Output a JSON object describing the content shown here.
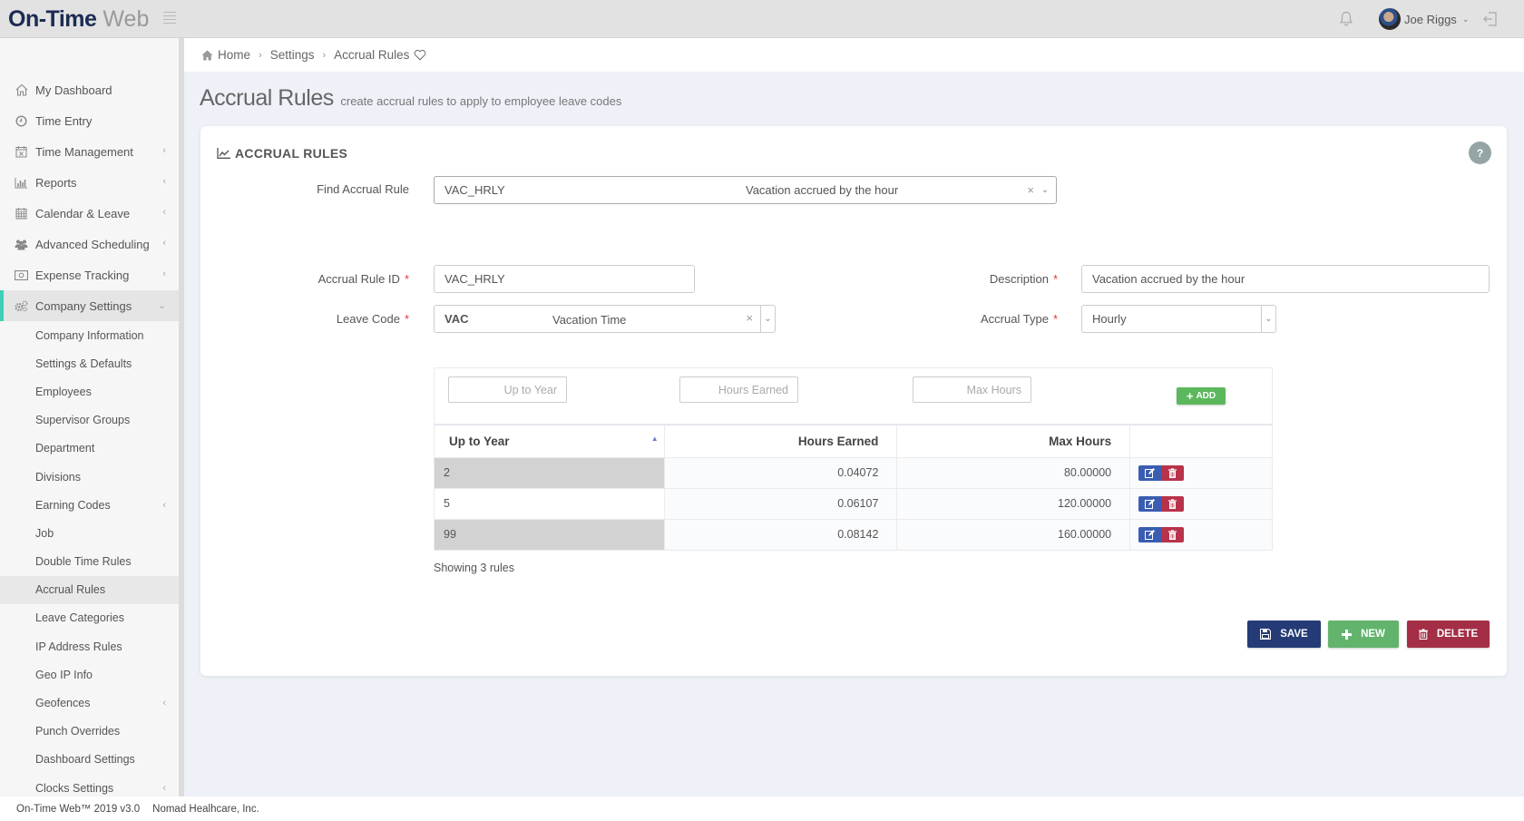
{
  "app": {
    "logo_bold": "On-Time",
    "logo_light": "Web",
    "user_name": "Joe Riggs"
  },
  "sidebar": {
    "items": [
      {
        "label": "My Dashboard",
        "icon": "home-icon",
        "has_children": false
      },
      {
        "label": "Time Entry",
        "icon": "clock-icon",
        "has_children": false
      },
      {
        "label": "Time Management",
        "icon": "calendar-x-icon",
        "has_children": true
      },
      {
        "label": "Reports",
        "icon": "bar-chart-icon",
        "has_children": true
      },
      {
        "label": "Calendar & Leave",
        "icon": "calendar-icon",
        "has_children": true
      },
      {
        "label": "Advanced Scheduling",
        "icon": "users-icon",
        "has_children": true
      },
      {
        "label": "Expense Tracking",
        "icon": "money-icon",
        "has_children": true
      },
      {
        "label": "Company Settings",
        "icon": "gears-icon",
        "has_children": true,
        "expanded": true,
        "active": true
      }
    ],
    "sub_items": [
      {
        "label": "Company Information"
      },
      {
        "label": "Settings & Defaults"
      },
      {
        "label": "Employees"
      },
      {
        "label": "Supervisor Groups"
      },
      {
        "label": "Department"
      },
      {
        "label": "Divisions"
      },
      {
        "label": "Earning Codes",
        "has_children": true
      },
      {
        "label": "Job"
      },
      {
        "label": "Double Time Rules"
      },
      {
        "label": "Accrual Rules",
        "current": true
      },
      {
        "label": "Leave Categories"
      },
      {
        "label": "IP Address Rules"
      },
      {
        "label": "Geo IP Info"
      },
      {
        "label": "Geofences",
        "has_children": true
      },
      {
        "label": "Punch Overrides"
      },
      {
        "label": "Dashboard Settings"
      },
      {
        "label": "Clocks Settings",
        "has_children": true
      }
    ]
  },
  "breadcrumb": [
    "Home",
    "Settings",
    "Accrual Rules"
  ],
  "page": {
    "title": "Accrual Rules",
    "subtitle": "create accrual rules to apply to employee leave codes"
  },
  "card": {
    "title": "ACCRUAL RULES",
    "help_label": "?",
    "find": {
      "label": "Find Accrual Rule",
      "code": "VAC_HRLY",
      "description": "Vacation accrued by the hour"
    },
    "accrual_rule_id": {
      "label": "Accrual Rule ID",
      "value": "VAC_HRLY"
    },
    "description": {
      "label": "Description",
      "value": "Vacation accrued by the hour"
    },
    "leave_code": {
      "label": "Leave Code",
      "code": "VAC",
      "name": "Vacation Time"
    },
    "accrual_type": {
      "label": "Accrual Type",
      "value": "Hourly"
    },
    "required_marker": "*"
  },
  "table": {
    "filters": {
      "up_to_year_placeholder": "Up to Year",
      "hours_earned_placeholder": "Hours Earned",
      "max_hours_placeholder": "Max Hours",
      "add_label": "ADD"
    },
    "columns": [
      "Up to Year",
      "Hours Earned",
      "Max Hours",
      ""
    ],
    "sort_column": "Up to Year",
    "sort_direction": "ascending",
    "rows": [
      {
        "up_to_year": "2",
        "hours_earned": "0.04072",
        "max_hours": "80.00000"
      },
      {
        "up_to_year": "5",
        "hours_earned": "0.06107",
        "max_hours": "120.00000"
      },
      {
        "up_to_year": "99",
        "hours_earned": "0.08142",
        "max_hours": "160.00000"
      }
    ],
    "showing": "Showing 3 rules"
  },
  "actions": {
    "save": "SAVE",
    "new": "NEW",
    "delete": "DELETE"
  },
  "footer": {
    "version": "On-Time Web™ 2019 v3.0",
    "company": "Nomad Healhcare, Inc."
  },
  "colors": {
    "brand_navy": "#1d2b53",
    "accent_teal": "#3ecfb6",
    "save": "#243b76",
    "new": "#62b46d",
    "delete": "#a32e45",
    "edit": "#3a5db3",
    "add": "#5cb85c"
  }
}
